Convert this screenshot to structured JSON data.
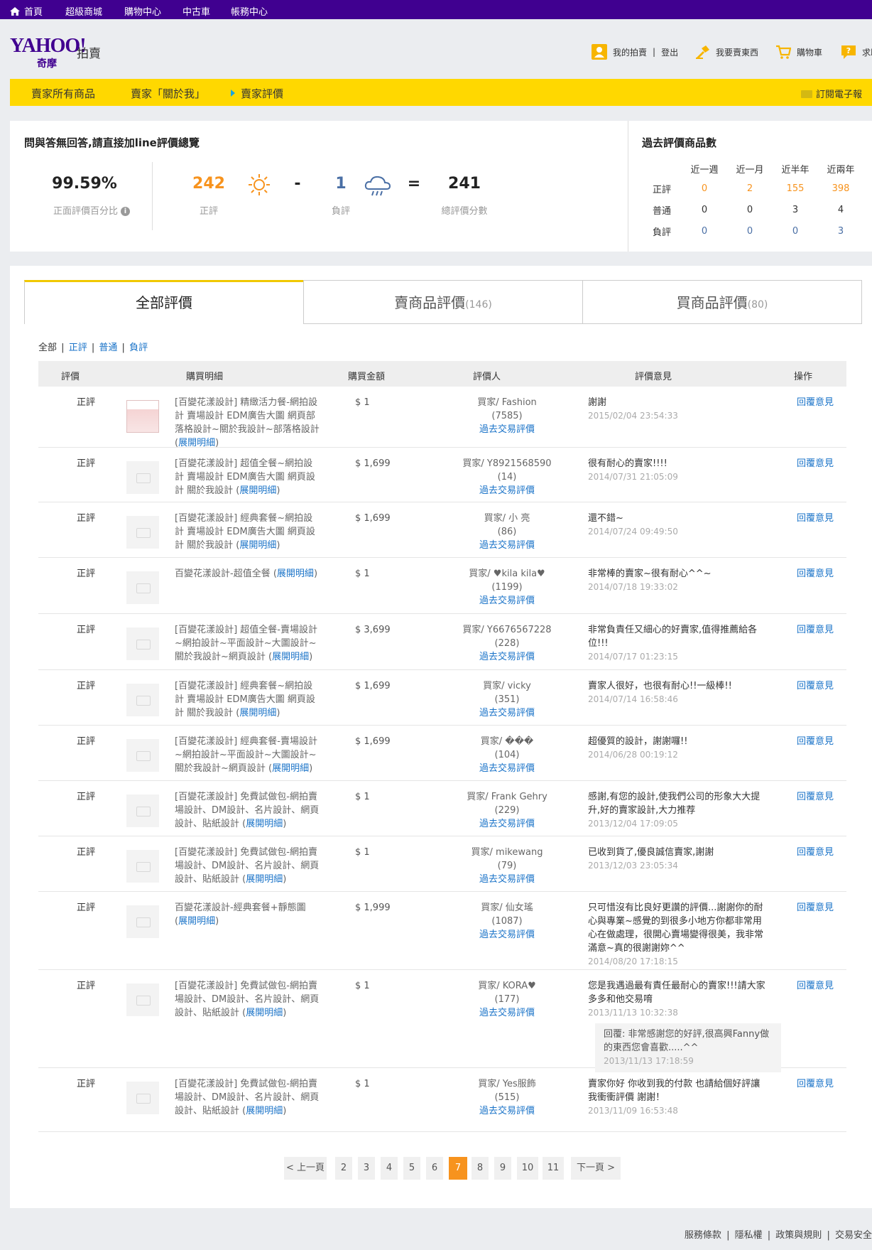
{
  "topnav": {
    "home": "首頁",
    "mall": "超級商城",
    "shopping": "購物中心",
    "used_car": "中古車",
    "account": "帳務中心"
  },
  "header": {
    "logo_main": "YAHOO!",
    "logo_sub": "奇摩",
    "logo_auction": "拍賣",
    "my_auction": "我的拍賣",
    "sep": "|",
    "logout": "登出",
    "sell": "我要賣東西",
    "cart": "購物車",
    "help": "求助"
  },
  "store_nav": {
    "all_items": "賣家所有商品",
    "about": "賣家「關於我」",
    "ratings": "賣家評價",
    "subscribe": "訂閱電子報"
  },
  "summary": {
    "title": "問與答無回答,請直接加line評價總覽",
    "positive_pct": "99.59%",
    "positive_pct_label": "正面評價百分比",
    "positive": "242",
    "positive_label": "正評",
    "minus": "-",
    "negative": "1",
    "negative_label": "負評",
    "equals": "=",
    "total": "241",
    "total_label": "總評價分數"
  },
  "past": {
    "title": "過去評價商品數",
    "cols": [
      "近一週",
      "近一月",
      "近半年",
      "近兩年"
    ],
    "rows": [
      {
        "label": "正評",
        "vals": [
          "0",
          "2",
          "155",
          "398"
        ]
      },
      {
        "label": "普通",
        "vals": [
          "0",
          "0",
          "3",
          "4"
        ]
      },
      {
        "label": "負評",
        "vals": [
          "0",
          "0",
          "0",
          "3"
        ]
      }
    ]
  },
  "tabs": {
    "all": "全部評價",
    "sell": "賣商品評價",
    "sell_count": "(146)",
    "buy": "買商品評價",
    "buy_count": "(80)"
  },
  "filters": {
    "all": "全部",
    "pos": "正評",
    "neu": "普通",
    "neg": "負評",
    "sep": "|"
  },
  "table_head": {
    "rating": "評價",
    "detail": "購買明細",
    "amount": "購買金額",
    "rater": "評價人",
    "comment": "評價意見",
    "action": "操作"
  },
  "rows": [
    {
      "rating": "正評",
      "desc": "[百變花漾設計] 精緻活力餐-網拍設計 賣場設計 EDM廣告大圖 網頁部落格設計~關於我設計~部落格設計",
      "expand": "展開明細",
      "price": "$ 1",
      "rater": "買家/ Fashion",
      "rater_count": "(7585)",
      "history": "過去交易評價",
      "comment": "謝謝",
      "date": "2015/02/04 23:54:33",
      "op": "回覆意見"
    },
    {
      "rating": "正評",
      "desc": "[百變花漾設計] 超值全餐~網拍設計 賣場設計 EDM廣告大圖 網頁設計 關於我設計",
      "expand": "展開明細",
      "price": "$ 1,699",
      "rater": "買家/ Y8921568590",
      "rater_count": "(14)",
      "history": "過去交易評價",
      "comment": "很有耐心的賣家!!!!",
      "date": "2014/07/31 21:05:09",
      "op": "回覆意見"
    },
    {
      "rating": "正評",
      "desc": "[百變花漾設計] 經典套餐~網拍設計 賣場設計 EDM廣告大圖 網頁設計 關於我設計",
      "expand": "展開明細",
      "price": "$ 1,699",
      "rater": "買家/ 小 亮",
      "rater_count": "(86)",
      "history": "過去交易評價",
      "comment": "還不錯~",
      "date": "2014/07/24 09:49:50",
      "op": "回覆意見"
    },
    {
      "rating": "正評",
      "desc": "百變花漾設計-超值全餐",
      "expand": "展開明細",
      "price": "$ 1",
      "rater": "買家/ ♥kila kila♥",
      "rater_count": "(1199)",
      "history": "過去交易評價",
      "comment": "非常棒的賣家~很有耐心^^~",
      "date": "2014/07/18 19:33:02",
      "op": "回覆意見"
    },
    {
      "rating": "正評",
      "desc": "[百變花漾設計] 超值全餐-賣場設計~網拍設計~平面設計~大圖設計~關於我設計~網頁設計",
      "expand": "展開明細",
      "price": "$ 3,699",
      "rater": "買家/ Y6676567228",
      "rater_count": "(228)",
      "history": "過去交易評價",
      "comment": "非常負責任又細心的好賣家,值得推薦給各位!!!",
      "date": "2014/07/17 01:23:15",
      "op": "回覆意見"
    },
    {
      "rating": "正評",
      "desc": "[百變花漾設計] 經典套餐~網拍設計 賣場設計 EDM廣告大圖 網頁設計 關於我設計",
      "expand": "展開明細",
      "price": "$ 1,699",
      "rater": "買家/ vicky",
      "rater_count": "(351)",
      "history": "過去交易評價",
      "comment": "賣家人很好，也很有耐心!!一級棒!!",
      "date": "2014/07/14 16:58:46",
      "op": "回覆意見"
    },
    {
      "rating": "正評",
      "desc": "[百變花漾設計] 經典套餐-賣場設計~網拍設計~平面設計~大圖設計~關於我設計~網頁設計",
      "expand": "展開明細",
      "price": "$ 1,699",
      "rater": "買家/ ���",
      "rater_count": "(104)",
      "history": "過去交易評價",
      "comment": "超優質的設計，謝謝囉!!",
      "date": "2014/06/28 00:19:12",
      "op": "回覆意見"
    },
    {
      "rating": "正評",
      "desc": "[百變花漾設計] 免費試做包-網拍賣場設計、DM設計、名片設計、網頁設計、貼紙設計",
      "expand": "展開明細",
      "price": "$ 1",
      "rater": "買家/ Frank Gehry",
      "rater_count": "(229)",
      "history": "過去交易評價",
      "comment": "感謝,有您的設計,使我們公司的形象大大提升,好的賣家設計,大力推荐",
      "date": "2013/12/04 17:09:05",
      "op": "回覆意見"
    },
    {
      "rating": "正評",
      "desc": "[百變花漾設計] 免費試做包-網拍賣場設計、DM設計、名片設計、網頁設計、貼紙設計",
      "expand": "展開明細",
      "price": "$ 1",
      "rater": "買家/ mikewang",
      "rater_count": "(79)",
      "history": "過去交易評價",
      "comment": "已收到貨了,優良誠信賣家,謝謝",
      "date": "2013/12/03 23:05:34",
      "op": "回覆意見"
    },
    {
      "rating": "正評",
      "desc": "百變花漾設計-經典套餐+靜態圖",
      "expand": "展開明細",
      "price": "$ 1,999",
      "rater": "買家/ 仙女瑤",
      "rater_count": "(1087)",
      "history": "過去交易評價",
      "comment": "只可惜沒有比良好更讚的評價...謝謝你的耐心與專業~感覺的到很多小地方你都非常用心在做處理，很開心賣場變得很美，我非常滿意~真的很謝謝妳^^",
      "date": "2014/08/20 17:18:15",
      "op": "回覆意見"
    },
    {
      "rating": "正評",
      "desc": "[百變花漾設計] 免費試做包-網拍賣場設計、DM設計、名片設計、網頁設計、貼紙設計",
      "expand": "展開明細",
      "price": "$ 1",
      "rater": "買家/ KORA♥",
      "rater_count": "(177)",
      "history": "過去交易評價",
      "comment": "您是我遇過最有責任最耐心的賣家!!!請大家多多和他交易唷",
      "date": "2013/11/13 10:32:38",
      "op": "回覆意見",
      "reply": "回覆: 非常感謝您的好評,很高興Fanny做的東西您會喜歡.....^^",
      "reply_date": "2013/11/13 17:18:59"
    },
    {
      "rating": "正評",
      "desc": "[百變花漾設計] 免費試做包-網拍賣場設計、DM設計、名片設計、網頁設計、貼紙設計",
      "expand": "展開明細",
      "price": "$ 1",
      "rater": "買家/ Yes服飾",
      "rater_count": "(515)",
      "history": "過去交易評價",
      "comment": "賣家你好 你收到我的付款 也請給個好評讓我衝衝評價 謝謝！",
      "date": "2013/11/09 16:53:48",
      "op": "回覆意見"
    }
  ],
  "pager": {
    "prev": "< 上一頁",
    "next": "下一頁 >",
    "pages": [
      "2",
      "3",
      "4",
      "5",
      "6",
      "7",
      "8",
      "9",
      "10",
      "11"
    ],
    "current": "7"
  },
  "footer": {
    "terms": "服務條款",
    "privacy": "隱私權",
    "policy": "政策與規則",
    "safety": "交易安全",
    "sep": "|"
  }
}
